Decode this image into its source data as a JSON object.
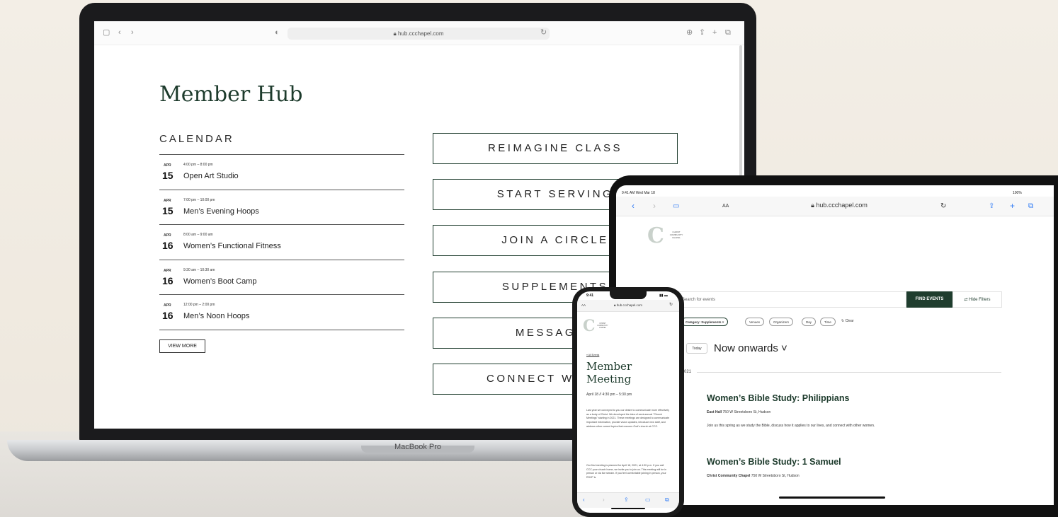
{
  "laptop": {
    "brand_label": "MacBook Pro",
    "browser": {
      "url": "hub.ccchapel.com",
      "lock_icon": "lock-icon"
    },
    "page": {
      "title": "Member Hub",
      "calendar_heading": "CALENDAR",
      "events": [
        {
          "month": "APR",
          "day": "15",
          "time": "4:00 pm – 8:00 pm",
          "name": "Open Art Studio"
        },
        {
          "month": "APR",
          "day": "15",
          "time": "7:00 pm – 10:00 pm",
          "name": "Men’s Evening Hoops"
        },
        {
          "month": "APR",
          "day": "16",
          "time": "8:00 am – 9:00 am",
          "name": "Women’s Functional Fitness"
        },
        {
          "month": "APR",
          "day": "16",
          "time": "9:30 am – 10:30 am",
          "name": "Women’s Boot Camp"
        },
        {
          "month": "APR",
          "day": "16",
          "time": "12:00 pm – 2:00 pm",
          "name": "Men’s Noon Hoops"
        }
      ],
      "view_more": "VIEW MORE",
      "buttons": [
        "REIMAGINE CLASS",
        "START SERVING",
        "JOIN A CIRCLE",
        "SUPPLEMENTS",
        "MESSAGES",
        "CONNECT WITH US"
      ]
    }
  },
  "tablet": {
    "status_left": "9:41 AM  Wed Mar 18",
    "status_right": "100%",
    "aa": "AA",
    "url": "hub.ccchapel.com",
    "logo_text": [
      "CHRIST",
      "COMMUNITY",
      "CHAPEL"
    ],
    "search_placeholder": "Search for events",
    "find_events": "FIND EVENTS",
    "hide_filters": "Hide Filters",
    "chips": [
      "Category: Supplements ×",
      "Venues",
      "Organizers",
      "Day",
      "Time",
      "↻ Clear"
    ],
    "today": "Today",
    "range": "Now onwards ˅",
    "year": "021",
    "events": [
      {
        "title": "Women’s Bible Study: Philippians",
        "venue": "East Hall",
        "address": "750 W Streetsboro St, Hudson",
        "desc": "Join us this spring as we study the Bible, discuss how it applies to our lives, and connect with other women."
      },
      {
        "title": "Women’s Bible Study: 1 Samuel",
        "venue": "Christ Community Chapel",
        "address": "750 W Streetsboro St, Hudson",
        "desc": ""
      }
    ]
  },
  "phone": {
    "time": "9:41",
    "aa": "AA",
    "url": "hub.ccchapel.com",
    "logo_text": [
      "CHRIST",
      "COMMUNITY",
      "CHAPEL"
    ],
    "back_link": "« All Events",
    "title": "Member Meeting",
    "date": "April 18 // 4:30 pm – 5:30 pm",
    "para1": "Last year we conveyed to you our desire to communicate more effectively as a body of Christ. We developed the idea of semi-annual \"Church Meetings\" starting in 2021. These meetings are designed to communicate important information, provide vision updates, introduce new staff, and address other current topics that concern God's church at CCC.",
    "para2": "Our first meeting is planned for April 18, 2021, at 4:30 p.m. If you call CCC your church home, we invite you to join us. This meeting will be in person or via live stream. If you feel comfortable joining in person, your RSVP is"
  }
}
